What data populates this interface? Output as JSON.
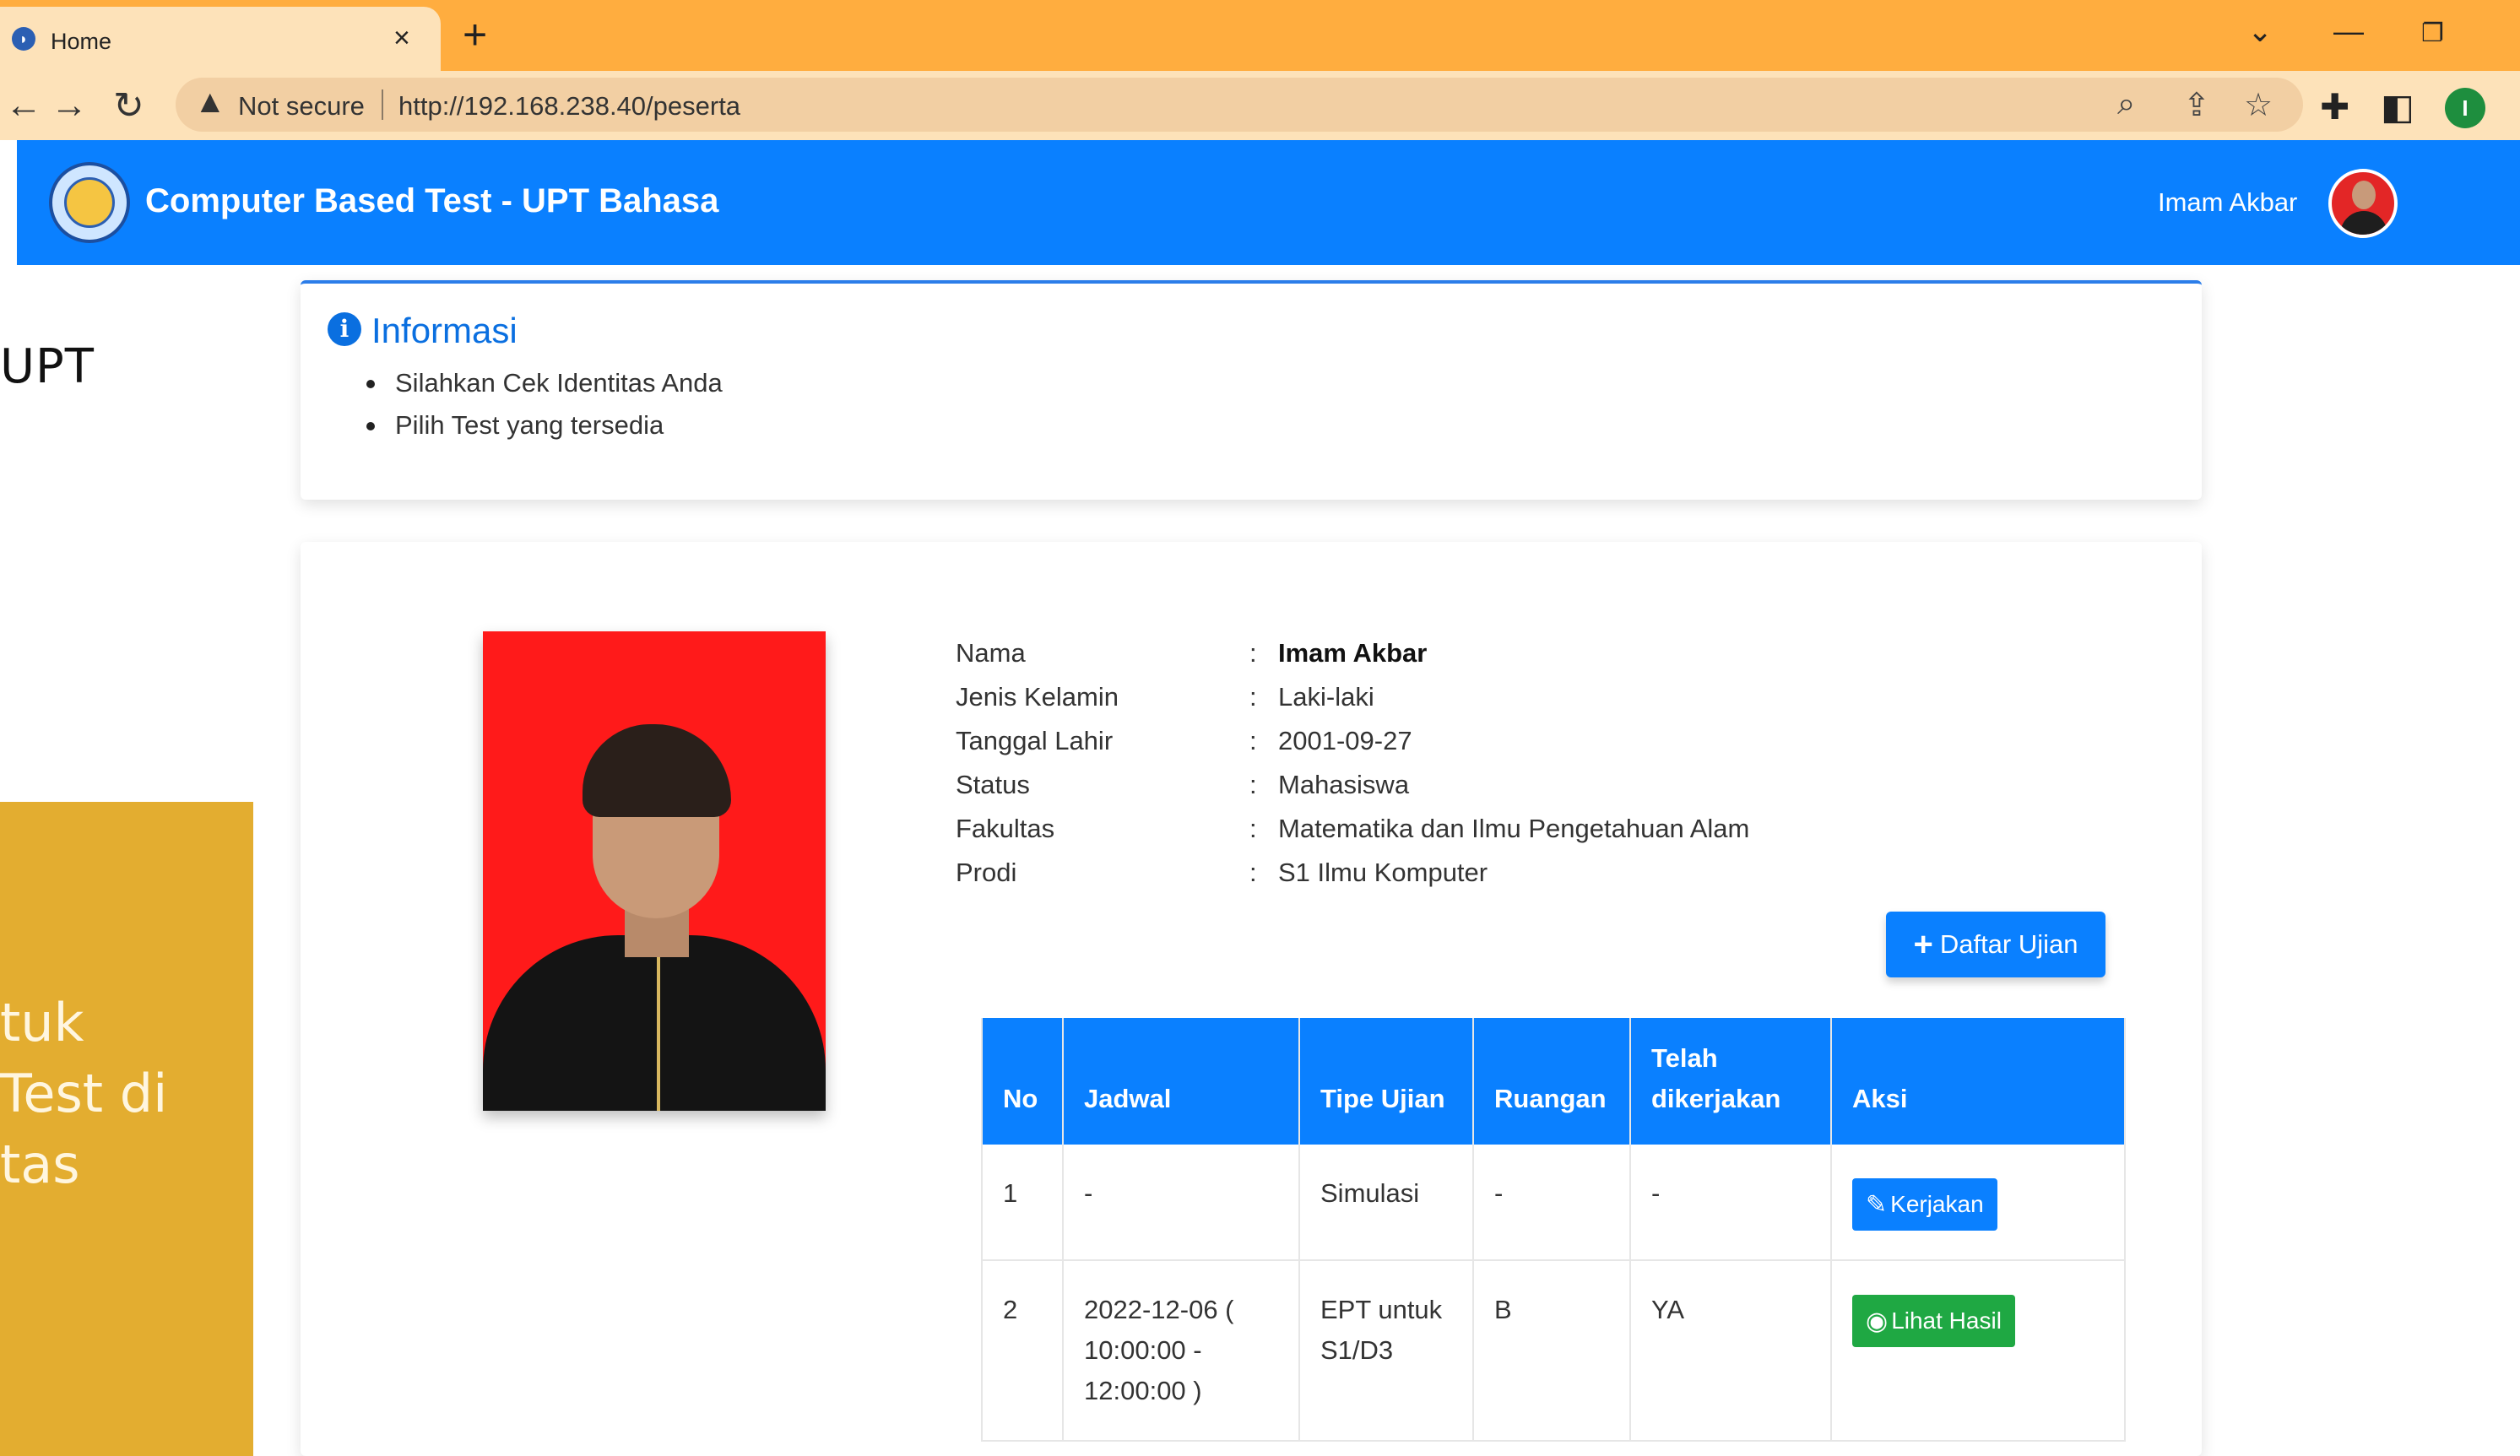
{
  "background": {
    "upt_text": "UPT",
    "gold_lines": [
      "tuk",
      "Test di",
      "tas"
    ]
  },
  "browser": {
    "tab_title": "Home",
    "tab_close": "×",
    "new_tab": "+",
    "security_label": "Not secure",
    "url": "http://192.168.238.40/peserta",
    "profile_initial": "I"
  },
  "navbar": {
    "brand": "Computer Based Test - UPT Bahasa",
    "user_name": "Imam Akbar"
  },
  "info": {
    "title": "Informasi",
    "items": [
      "Silahkan Cek Identitas Anda",
      "Pilih Test yang tersedia"
    ]
  },
  "profile": {
    "fields": [
      {
        "label": "Nama",
        "value": "Imam Akbar"
      },
      {
        "label": "Jenis Kelamin",
        "value": "Laki-laki"
      },
      {
        "label": "Tanggal Lahir",
        "value": "2001-09-27"
      },
      {
        "label": "Status",
        "value": "Mahasiswa"
      },
      {
        "label": "Fakultas",
        "value": "Matematika dan Ilmu Pengetahuan Alam"
      },
      {
        "label": "Prodi",
        "value": "S1 Ilmu Komputer"
      }
    ],
    "colon": ":"
  },
  "actions": {
    "daftar_label": "Daftar Ujian"
  },
  "table": {
    "headers": [
      "No",
      "Jadwal",
      "Tipe Ujian",
      "Ruangan",
      "Telah dikerjakan",
      "Aksi"
    ],
    "rows": [
      {
        "no": "1",
        "jadwal": "-",
        "tipe": "Simulasi",
        "ruangan": "-",
        "dikerjakan": "-",
        "aksi": "Kerjakan"
      },
      {
        "no": "2",
        "jadwal": "2022-12-06 ( 10:00:00 - 12:00:00 )",
        "tipe": "EPT untuk S1/D3",
        "ruangan": "B",
        "dikerjakan": "YA",
        "aksi": "Lihat Hasil"
      }
    ]
  },
  "colors": {
    "primary": "#0a80ff",
    "success": "#1fa843",
    "tabbar": "#ffad3f",
    "gold": "#e3ad30"
  }
}
